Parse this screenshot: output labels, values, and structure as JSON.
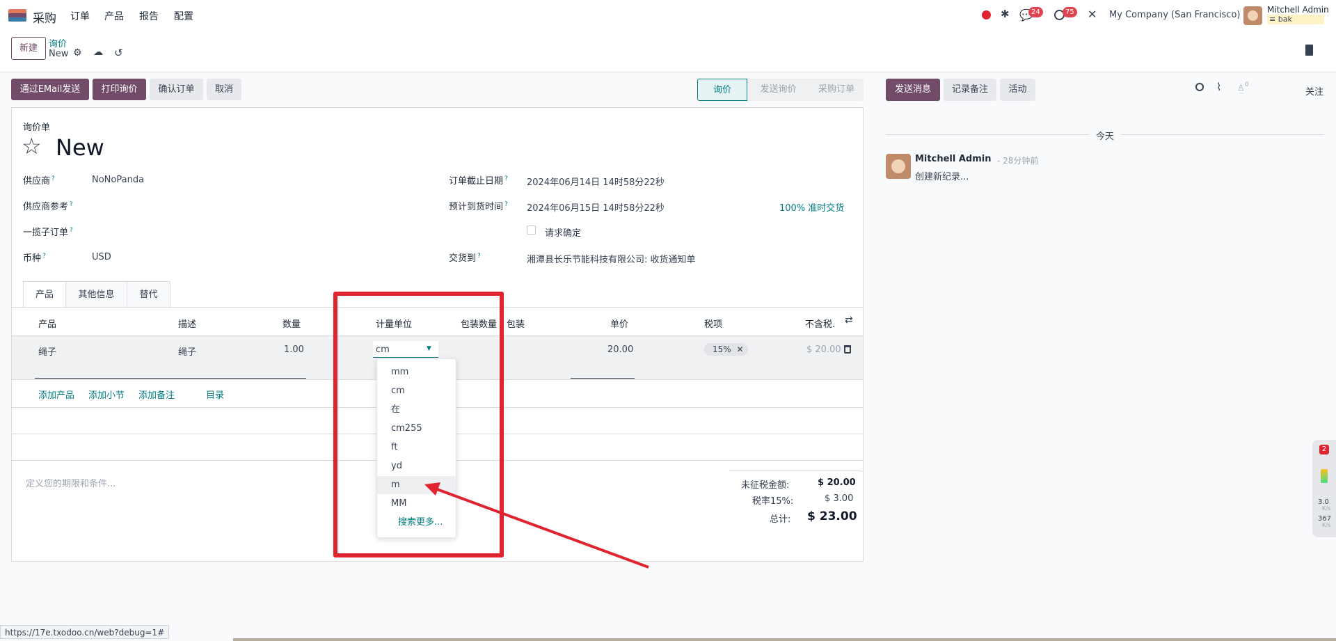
{
  "navbar": {
    "app_name": "采购",
    "menu": [
      "订单",
      "产品",
      "报告",
      "配置"
    ],
    "chat_badge": "24",
    "activity_badge": "75",
    "company": "My Company (San Francisco)",
    "user_name": "Mitchell Admin",
    "user_db": "bak"
  },
  "control_panel": {
    "new_button": "新建",
    "breadcrumb_parent": "询价",
    "breadcrumb_current": "New"
  },
  "actions": {
    "send_email": "通过EMail发送",
    "print_rfq": "打印询价",
    "confirm_order": "确认订单",
    "cancel": "取消"
  },
  "statusbar": [
    "询价",
    "发送询价",
    "采购订单"
  ],
  "form": {
    "title_label": "询价单",
    "name": "New",
    "vendor_label": "供应商",
    "vendor": "NoNoPanda",
    "vendor_ref_label": "供应商参考",
    "blanket_label": "一揽子订单",
    "currency_label": "币种",
    "currency": "USD",
    "deadline_label": "订单截止日期",
    "deadline": "2024年06月14日 14时58分22秒",
    "expected_label": "预计到货时间",
    "expected": "2024年06月15日 14时58分22秒",
    "on_time": "100% 准时交货",
    "ask_confirm_label": "请求确定",
    "deliver_to_label": "交货到",
    "deliver_to": "湘潭县长乐节能科技有限公司: 收货通知单"
  },
  "tabs": [
    "产品",
    "其他信息",
    "替代"
  ],
  "lines": {
    "headers": [
      "产品",
      "描述",
      "数量",
      "计量单位",
      "包装数量",
      "包装",
      "单价",
      "税项",
      "不含税."
    ],
    "row": {
      "product": "绳子",
      "description": "绳子",
      "quantity": "1.00",
      "uom": "cm",
      "price": "20.00",
      "tax": "15%",
      "subtotal": "$ 20.00"
    },
    "add_product": "添加产品",
    "add_section": "添加小节",
    "add_note": "添加备注",
    "catalog": "目录"
  },
  "uom_options": [
    "mm",
    "cm",
    "在",
    "cm255",
    "ft",
    "yd",
    "m",
    "MM"
  ],
  "uom_search_more": "搜索更多...",
  "terms_placeholder": "定义您的期限和条件...",
  "totals": {
    "untaxed_label": "未征税金额:",
    "untaxed": "$ 20.00",
    "tax_label": "税率15%:",
    "tax": "$ 3.00",
    "total_label": "总计:",
    "total": "$ 23.00"
  },
  "chatter": {
    "send_message": "发送消息",
    "log_note": "记录备注",
    "activity": "活动",
    "follower_count": "0",
    "follow": "关注",
    "date_separator": "今天",
    "message_author": "Mitchell Admin",
    "message_time": "- 28分钟前",
    "message_body": "创建新纪录..."
  },
  "widget": {
    "badge": "2",
    "up_value": "3.0",
    "up_unit": "K/s",
    "down_value": "367",
    "down_unit": "K/s"
  },
  "status_url": "https://17e.txodoo.cn/web?debug=1#",
  "colors": {
    "brand": "#714b67",
    "link": "#017e84",
    "annotation": "#e0242f"
  }
}
